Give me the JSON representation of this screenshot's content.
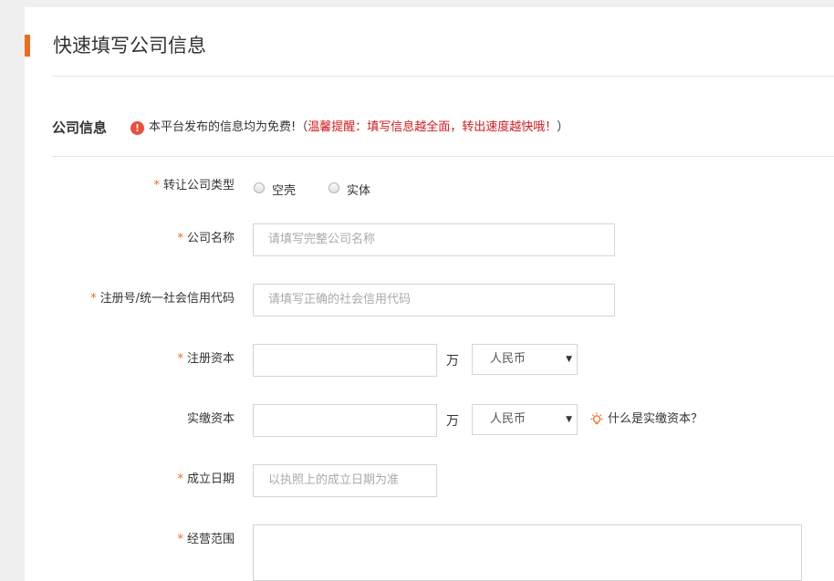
{
  "page": {
    "title": "快速填写公司信息"
  },
  "section": {
    "title": "公司信息",
    "notice_prefix": "本平台发布的信息均为免费!（",
    "notice_highlight": "温馨提醒：填写信息越全面，转出速度越快哦！",
    "notice_suffix": "）"
  },
  "form": {
    "required_mark": "*",
    "company_type": {
      "label": "转让公司类型",
      "options": [
        "空壳",
        "实体"
      ]
    },
    "company_name": {
      "label": "公司名称",
      "placeholder": "请填写完整公司名称"
    },
    "credit_code": {
      "label": "注册号/统一社会信用代码",
      "placeholder": "请填写正确的社会信用代码"
    },
    "registered_capital": {
      "label": "注册资本",
      "unit": "万",
      "currency": "人民币"
    },
    "paid_capital": {
      "label": "实缴资本",
      "unit": "万",
      "currency": "人民币",
      "help": "什么是实缴资本？"
    },
    "established_date": {
      "label": "成立日期",
      "placeholder": "以执照上的成立日期为准"
    },
    "business_scope": {
      "label": "经营范围"
    }
  },
  "colors": {
    "accent": "#ef6c1f",
    "warning": "#d6191c"
  }
}
